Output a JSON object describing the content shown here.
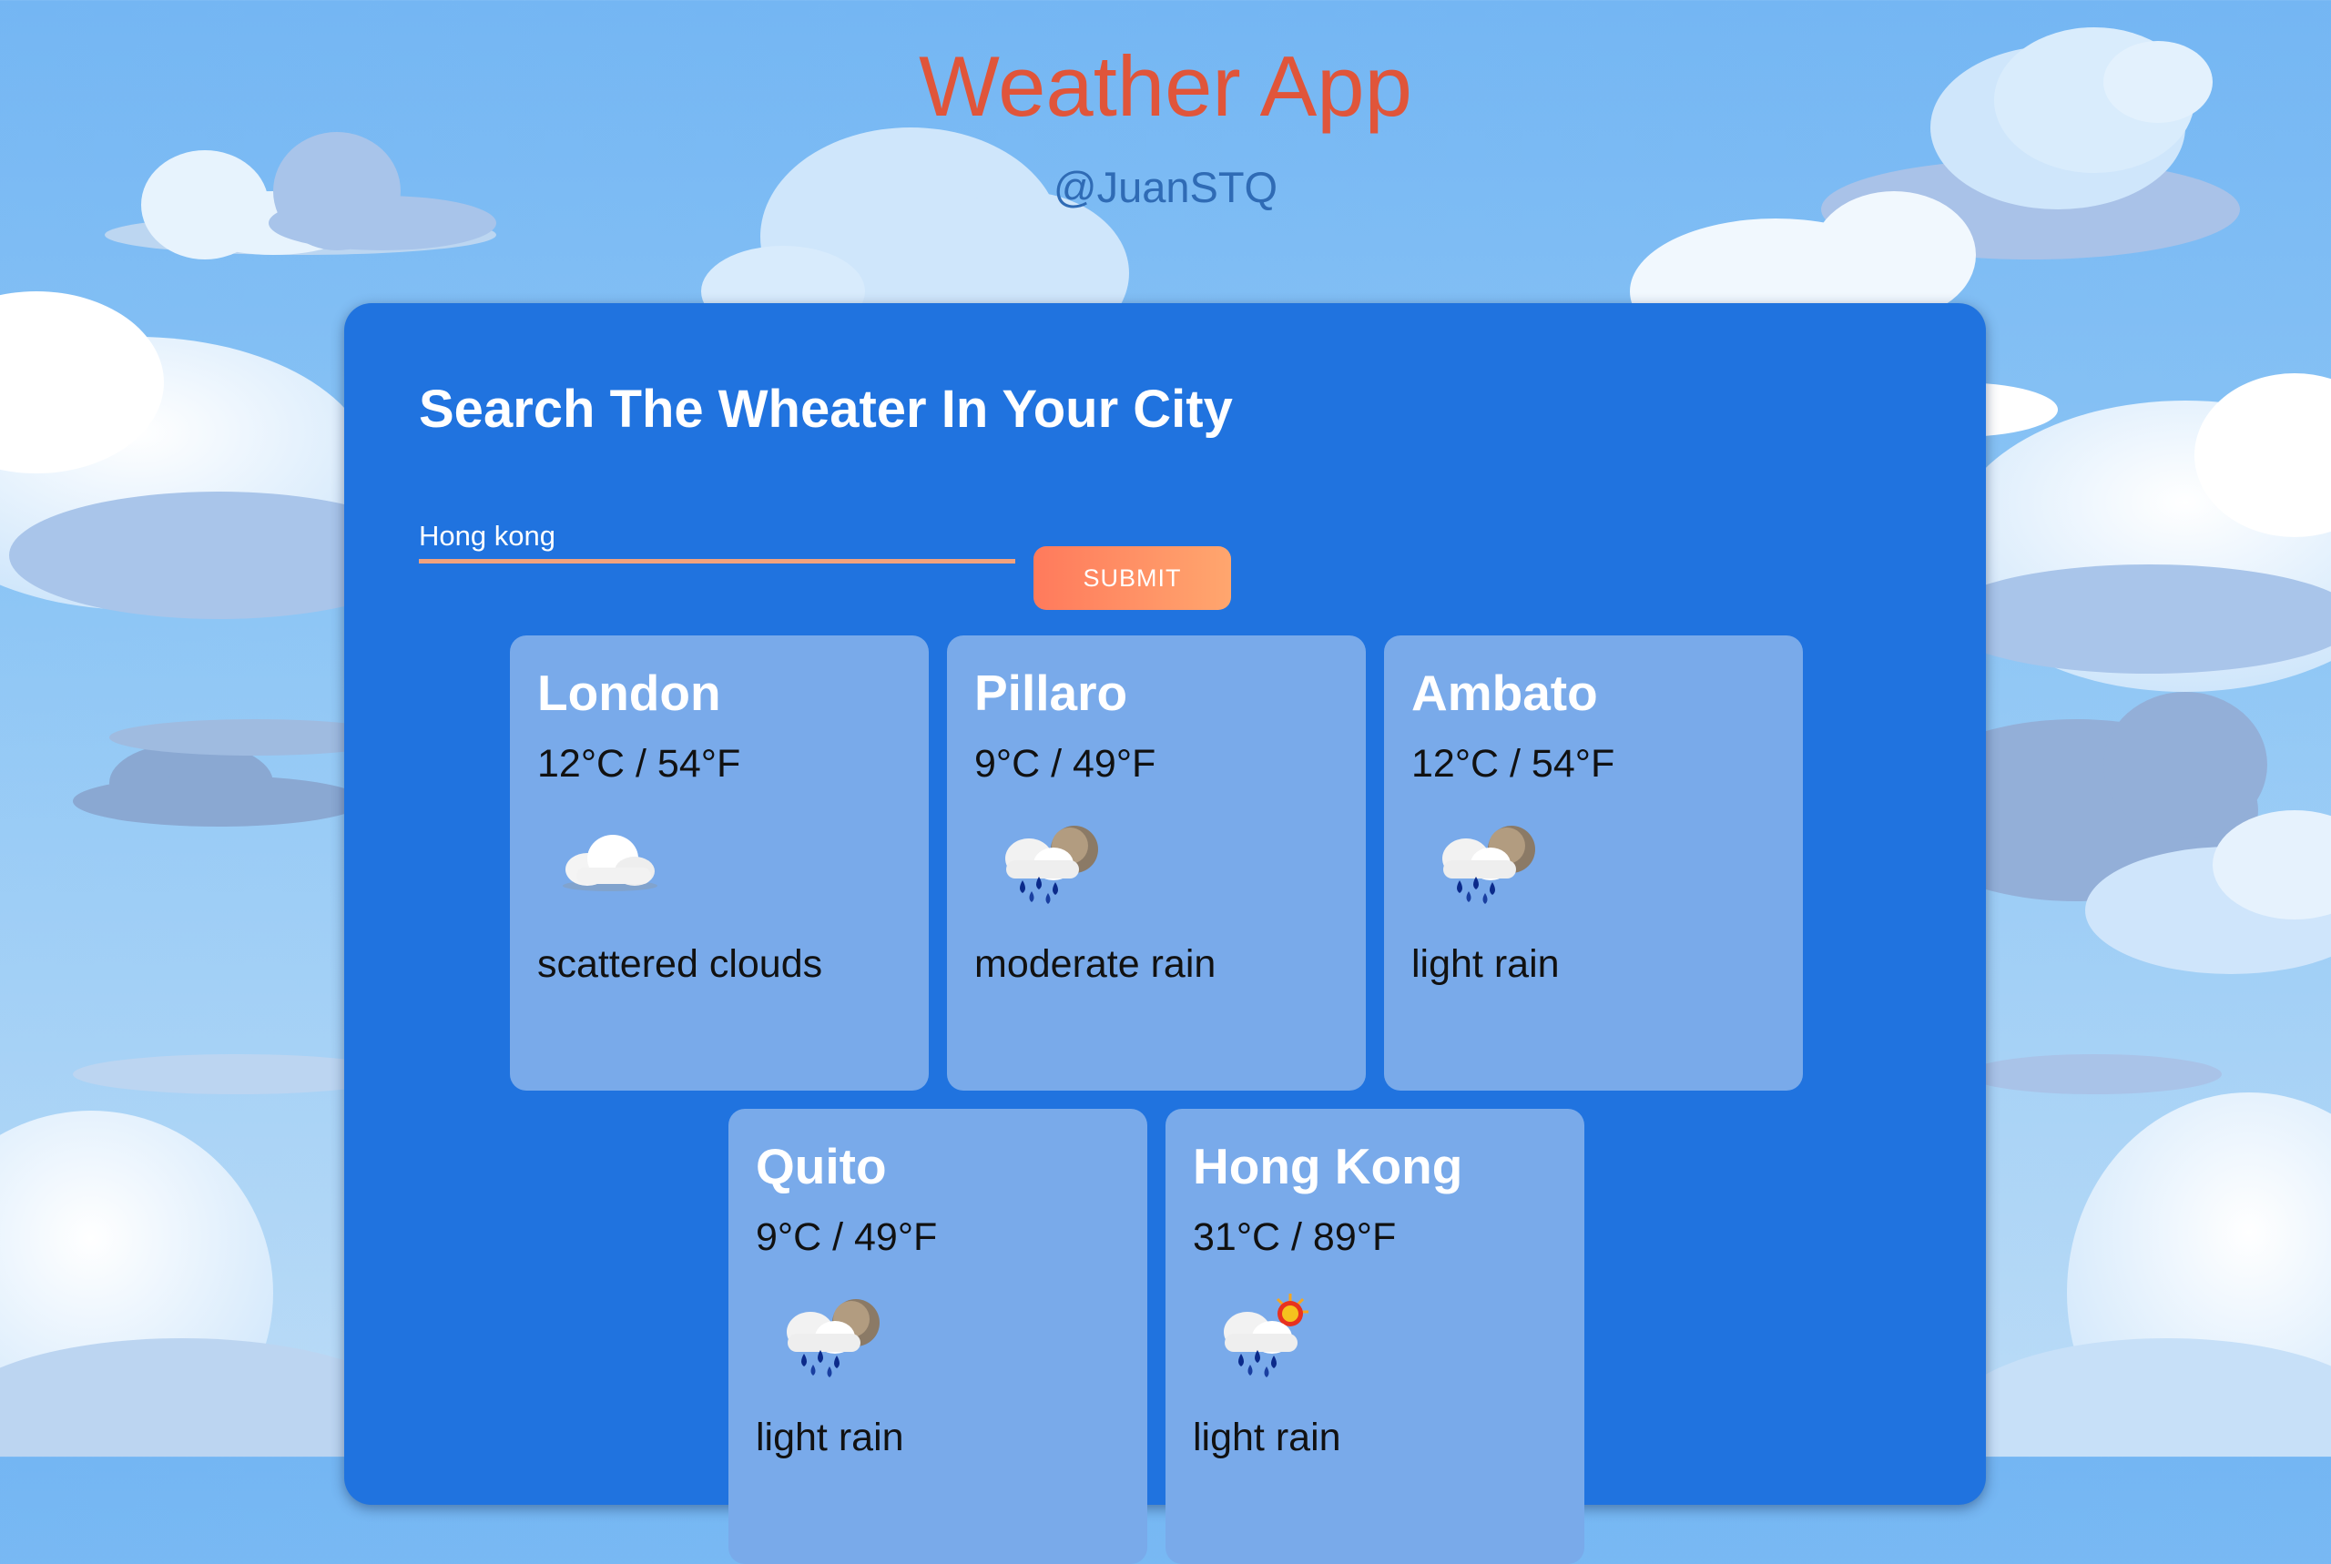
{
  "header": {
    "title": "Weather App",
    "handle": "@JuanSTQ"
  },
  "panel": {
    "heading": "Search The Wheater In Your City"
  },
  "search": {
    "value": "Hong kong",
    "submit_label": "SUBMIT"
  },
  "cards": [
    {
      "city": "London",
      "temp": "12°C / 54°F",
      "description": "scattered clouds",
      "icon": "cloud-icon"
    },
    {
      "city": "Pillaro",
      "temp": "9°C / 49°F",
      "description": "moderate rain",
      "icon": "rain-night-icon"
    },
    {
      "city": "Ambato",
      "temp": "12°C / 54°F",
      "description": "light rain",
      "icon": "rain-night-icon"
    },
    {
      "city": "Quito",
      "temp": "9°C / 49°F",
      "description": "light rain",
      "icon": "rain-night-icon"
    },
    {
      "city": "Hong Kong",
      "temp": "31°C / 89°F",
      "description": "light rain",
      "icon": "rain-day-icon"
    }
  ],
  "colors": {
    "title": "#e0553a",
    "handle": "#2f6bb5",
    "panel": "#2073df",
    "card": "#79aaea",
    "submit_start": "#ff7a5c",
    "submit_end": "#ffa66e"
  }
}
